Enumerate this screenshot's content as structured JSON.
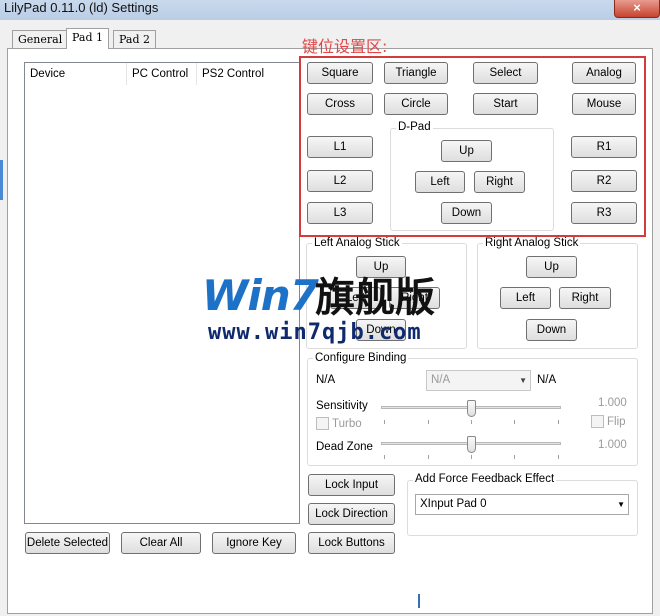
{
  "window": {
    "title": "LilyPad 0.11.0 (ld) Settings",
    "close_glyph": "×"
  },
  "tabs": [
    {
      "label": "General"
    },
    {
      "label": "Pad 1"
    },
    {
      "label": "Pad 2"
    }
  ],
  "device_list": {
    "columns": [
      "Device",
      "PC Control",
      "PS2 Control"
    ]
  },
  "bottom_buttons": {
    "delete_selected": "Delete Selected",
    "clear_all": "Clear All",
    "ignore_key": "Ignore Key"
  },
  "annotation": "键位设置区:",
  "face_buttons": {
    "square": "Square",
    "triangle": "Triangle",
    "select": "Select",
    "analog": "Analog",
    "cross": "Cross",
    "circle": "Circle",
    "start": "Start",
    "mouse": "Mouse"
  },
  "shoulder": {
    "l1": "L1",
    "l2": "L2",
    "l3": "L3",
    "r1": "R1",
    "r2": "R2",
    "r3": "R3"
  },
  "dpad": {
    "label": "D-Pad",
    "up": "Up",
    "left": "Left",
    "right": "Right",
    "down": "Down"
  },
  "left_stick": {
    "label": "Left Analog Stick",
    "up": "Up",
    "left": "Left",
    "right": "Right",
    "down": "Down"
  },
  "right_stick": {
    "label": "Right Analog Stick",
    "up": "Up",
    "left": "Left",
    "right": "Right",
    "down": "Down"
  },
  "configure": {
    "label": "Configure Binding",
    "na_left": "N/A",
    "na_select": "N/A",
    "na_right": "N/A",
    "sensitivity_label": "Sensitivity",
    "sensitivity_value": "1.000",
    "sensitivity_level": 0.5,
    "turbo_label": "Turbo",
    "flip_label": "Flip",
    "deadzone_label": "Dead Zone",
    "deadzone_value": "1.000",
    "deadzone_level": 0.5
  },
  "lock_buttons": {
    "lock_input": "Lock Input",
    "lock_direction": "Lock Direction",
    "lock_buttons": "Lock Buttons"
  },
  "force_feedback": {
    "label": "Add Force Feedback Effect",
    "selected": "XInput Pad 0"
  },
  "watermark": {
    "brand": "Win7",
    "cn": "旗舰版",
    "url": "www.win7qjb.com"
  }
}
